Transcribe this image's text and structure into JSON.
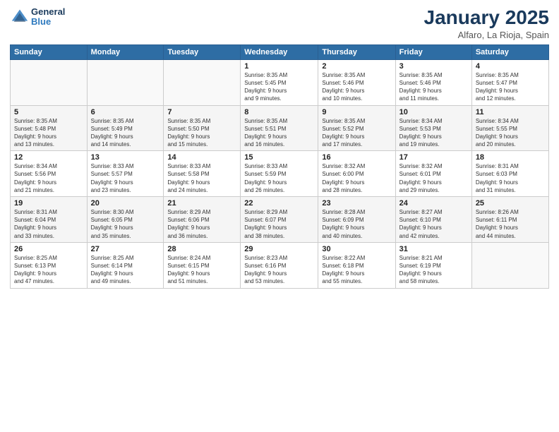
{
  "header": {
    "logo_line1": "General",
    "logo_line2": "Blue",
    "month": "January 2025",
    "location": "Alfaro, La Rioja, Spain"
  },
  "weekdays": [
    "Sunday",
    "Monday",
    "Tuesday",
    "Wednesday",
    "Thursday",
    "Friday",
    "Saturday"
  ],
  "weeks": [
    [
      {
        "day": "",
        "info": ""
      },
      {
        "day": "",
        "info": ""
      },
      {
        "day": "",
        "info": ""
      },
      {
        "day": "1",
        "info": "Sunrise: 8:35 AM\nSunset: 5:45 PM\nDaylight: 9 hours\nand 9 minutes."
      },
      {
        "day": "2",
        "info": "Sunrise: 8:35 AM\nSunset: 5:46 PM\nDaylight: 9 hours\nand 10 minutes."
      },
      {
        "day": "3",
        "info": "Sunrise: 8:35 AM\nSunset: 5:46 PM\nDaylight: 9 hours\nand 11 minutes."
      },
      {
        "day": "4",
        "info": "Sunrise: 8:35 AM\nSunset: 5:47 PM\nDaylight: 9 hours\nand 12 minutes."
      }
    ],
    [
      {
        "day": "5",
        "info": "Sunrise: 8:35 AM\nSunset: 5:48 PM\nDaylight: 9 hours\nand 13 minutes."
      },
      {
        "day": "6",
        "info": "Sunrise: 8:35 AM\nSunset: 5:49 PM\nDaylight: 9 hours\nand 14 minutes."
      },
      {
        "day": "7",
        "info": "Sunrise: 8:35 AM\nSunset: 5:50 PM\nDaylight: 9 hours\nand 15 minutes."
      },
      {
        "day": "8",
        "info": "Sunrise: 8:35 AM\nSunset: 5:51 PM\nDaylight: 9 hours\nand 16 minutes."
      },
      {
        "day": "9",
        "info": "Sunrise: 8:35 AM\nSunset: 5:52 PM\nDaylight: 9 hours\nand 17 minutes."
      },
      {
        "day": "10",
        "info": "Sunrise: 8:34 AM\nSunset: 5:53 PM\nDaylight: 9 hours\nand 19 minutes."
      },
      {
        "day": "11",
        "info": "Sunrise: 8:34 AM\nSunset: 5:55 PM\nDaylight: 9 hours\nand 20 minutes."
      }
    ],
    [
      {
        "day": "12",
        "info": "Sunrise: 8:34 AM\nSunset: 5:56 PM\nDaylight: 9 hours\nand 21 minutes."
      },
      {
        "day": "13",
        "info": "Sunrise: 8:33 AM\nSunset: 5:57 PM\nDaylight: 9 hours\nand 23 minutes."
      },
      {
        "day": "14",
        "info": "Sunrise: 8:33 AM\nSunset: 5:58 PM\nDaylight: 9 hours\nand 24 minutes."
      },
      {
        "day": "15",
        "info": "Sunrise: 8:33 AM\nSunset: 5:59 PM\nDaylight: 9 hours\nand 26 minutes."
      },
      {
        "day": "16",
        "info": "Sunrise: 8:32 AM\nSunset: 6:00 PM\nDaylight: 9 hours\nand 28 minutes."
      },
      {
        "day": "17",
        "info": "Sunrise: 8:32 AM\nSunset: 6:01 PM\nDaylight: 9 hours\nand 29 minutes."
      },
      {
        "day": "18",
        "info": "Sunrise: 8:31 AM\nSunset: 6:03 PM\nDaylight: 9 hours\nand 31 minutes."
      }
    ],
    [
      {
        "day": "19",
        "info": "Sunrise: 8:31 AM\nSunset: 6:04 PM\nDaylight: 9 hours\nand 33 minutes."
      },
      {
        "day": "20",
        "info": "Sunrise: 8:30 AM\nSunset: 6:05 PM\nDaylight: 9 hours\nand 35 minutes."
      },
      {
        "day": "21",
        "info": "Sunrise: 8:29 AM\nSunset: 6:06 PM\nDaylight: 9 hours\nand 36 minutes."
      },
      {
        "day": "22",
        "info": "Sunrise: 8:29 AM\nSunset: 6:07 PM\nDaylight: 9 hours\nand 38 minutes."
      },
      {
        "day": "23",
        "info": "Sunrise: 8:28 AM\nSunset: 6:09 PM\nDaylight: 9 hours\nand 40 minutes."
      },
      {
        "day": "24",
        "info": "Sunrise: 8:27 AM\nSunset: 6:10 PM\nDaylight: 9 hours\nand 42 minutes."
      },
      {
        "day": "25",
        "info": "Sunrise: 8:26 AM\nSunset: 6:11 PM\nDaylight: 9 hours\nand 44 minutes."
      }
    ],
    [
      {
        "day": "26",
        "info": "Sunrise: 8:25 AM\nSunset: 6:13 PM\nDaylight: 9 hours\nand 47 minutes."
      },
      {
        "day": "27",
        "info": "Sunrise: 8:25 AM\nSunset: 6:14 PM\nDaylight: 9 hours\nand 49 minutes."
      },
      {
        "day": "28",
        "info": "Sunrise: 8:24 AM\nSunset: 6:15 PM\nDaylight: 9 hours\nand 51 minutes."
      },
      {
        "day": "29",
        "info": "Sunrise: 8:23 AM\nSunset: 6:16 PM\nDaylight: 9 hours\nand 53 minutes."
      },
      {
        "day": "30",
        "info": "Sunrise: 8:22 AM\nSunset: 6:18 PM\nDaylight: 9 hours\nand 55 minutes."
      },
      {
        "day": "31",
        "info": "Sunrise: 8:21 AM\nSunset: 6:19 PM\nDaylight: 9 hours\nand 58 minutes."
      },
      {
        "day": "",
        "info": ""
      }
    ]
  ]
}
